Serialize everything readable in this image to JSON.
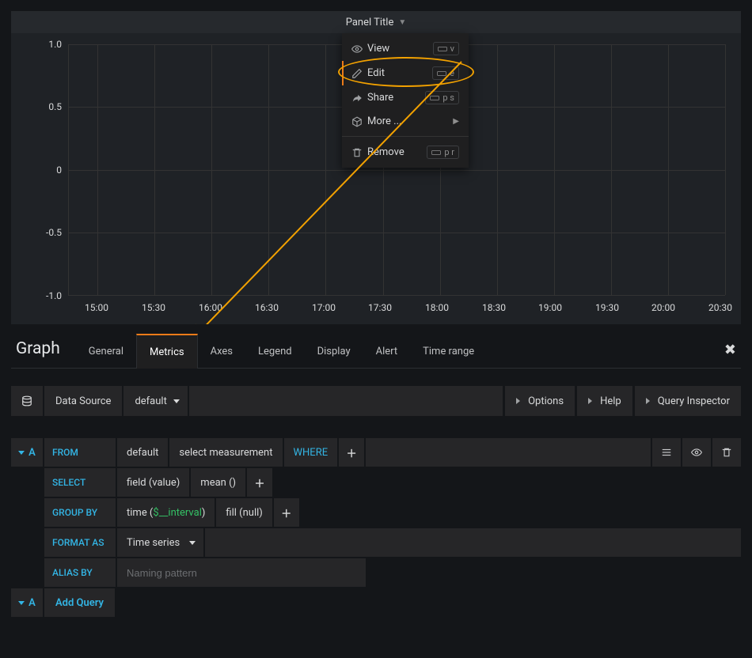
{
  "panel": {
    "title": "Panel Title"
  },
  "menu": {
    "view": {
      "label": "View",
      "shortcut": "v"
    },
    "edit": {
      "label": "Edit",
      "shortcut": "e"
    },
    "share": {
      "label": "Share",
      "shortcut": "p s"
    },
    "more": {
      "label": "More ..."
    },
    "remove": {
      "label": "Remove",
      "shortcut": "p r"
    }
  },
  "editor": {
    "title": "Graph",
    "tabs": {
      "general": "General",
      "metrics": "Metrics",
      "axes": "Axes",
      "legend": "Legend",
      "display": "Display",
      "alert": "Alert",
      "time_range": "Time range"
    }
  },
  "toolbar": {
    "data_source_label": "Data Source",
    "data_source_value": "default",
    "options": "Options",
    "help": "Help",
    "inspector": "Query Inspector"
  },
  "query": {
    "letter": "A",
    "from_label": "FROM",
    "from_default": "default",
    "from_measurement": "select measurement",
    "where_label": "WHERE",
    "select_label": "SELECT",
    "select_field": "field (value)",
    "select_mean": "mean ()",
    "groupby_label": "GROUP BY",
    "groupby_time_prefix": "time (",
    "groupby_time_var": "$__interval",
    "groupby_time_suffix": ")",
    "groupby_fill": "fill (null)",
    "format_label": "FORMAT AS",
    "format_value": "Time series",
    "alias_label": "ALIAS BY",
    "alias_placeholder": "Naming pattern",
    "add_query": "Add Query"
  },
  "chart_data": {
    "type": "line",
    "title": "Panel Title",
    "xlabel": "",
    "ylabel": "",
    "y_ticks": [
      "1.0",
      "0.5",
      "0",
      "-0.5",
      "-1.0"
    ],
    "x_ticks": [
      "15:00",
      "15:30",
      "16:00",
      "16:30",
      "17:00",
      "17:30",
      "18:00",
      "18:30",
      "19:00",
      "19:30",
      "20:00",
      "20:30"
    ],
    "ylim": [
      -1.0,
      1.0
    ],
    "series": [],
    "grid": true
  }
}
